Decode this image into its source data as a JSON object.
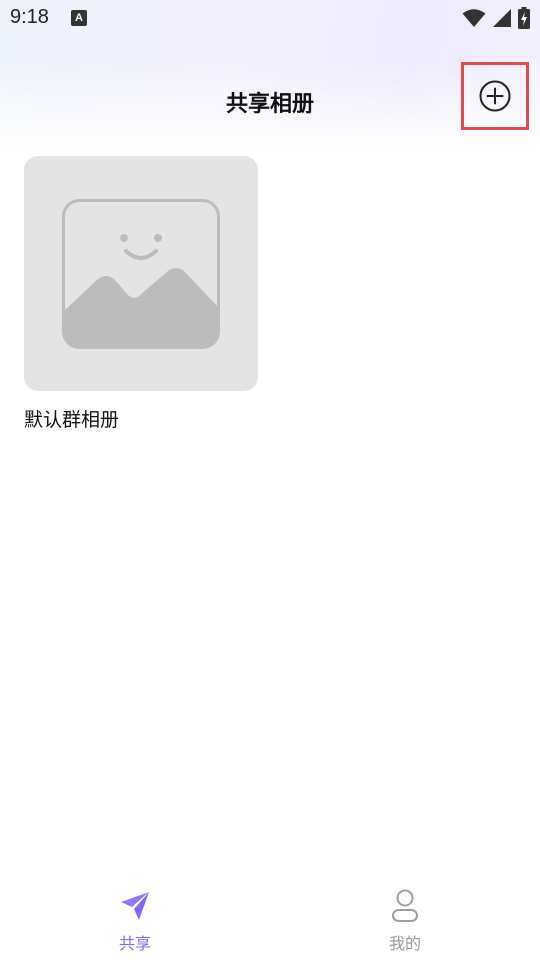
{
  "status_bar": {
    "time": "9:18",
    "notification_icon": "a-icon",
    "indicators": [
      "wifi-icon",
      "signal-icon",
      "battery-charging-icon"
    ]
  },
  "header": {
    "title": "共享相册",
    "add_icon": "plus-circle-icon"
  },
  "albums": [
    {
      "name": "默认群相册",
      "cover": "placeholder-image-icon"
    }
  ],
  "bottom_nav": {
    "active_color": "#7b6cf6",
    "inactive_color": "#9a9a9a",
    "items": [
      {
        "label": "共享",
        "icon": "paper-plane-icon",
        "active": true
      },
      {
        "label": "我的",
        "icon": "person-icon",
        "active": false
      }
    ]
  },
  "colors": {
    "highlight_border": "#e64a4f",
    "placeholder_bg": "#e4e4e4"
  }
}
